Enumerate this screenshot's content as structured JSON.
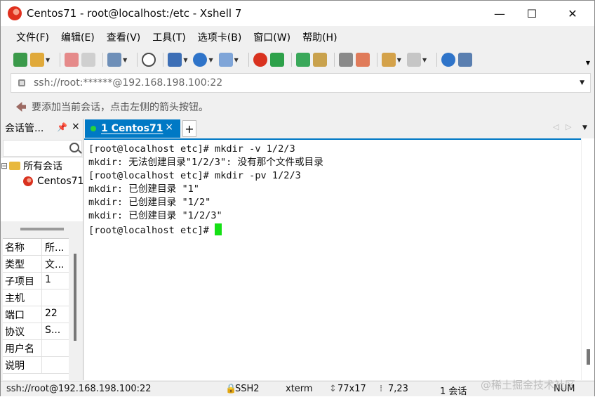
{
  "window": {
    "title": "Centos71 - root@localhost:/etc - Xshell 7",
    "minimize_glyph": "—",
    "maximize_glyph": "☐",
    "close_glyph": "✕"
  },
  "menu": [
    "文件(F)",
    "编辑(E)",
    "查看(V)",
    "工具(T)",
    "选项卡(B)",
    "窗口(W)",
    "帮助(H)"
  ],
  "toolbar_icons": [
    "new-session-icon",
    "open-folder-icon",
    "reconnect-icon",
    "disconnect-icon",
    "properties-icon",
    "find-icon",
    "transfer-icon",
    "globe-icon",
    "font-icon",
    "xshell-icon",
    "xftp-icon",
    "fullscreen-icon",
    "lock-icon",
    "keyboard-icon",
    "highlight-icon",
    "compose-icon",
    "layout-icon",
    "help-icon",
    "chat-icon"
  ],
  "address": {
    "text": "ssh://root:******@192.168.198.100:22"
  },
  "hint": {
    "text": "要添加当前会话，点击左侧的箭头按钮。"
  },
  "session_panel": {
    "title": "会话管...",
    "pin_glyph": "ᵖ",
    "close_glyph": "×",
    "tree_root": "所有会话",
    "tree_expand": "⊟",
    "tree_child": "Centos71",
    "properties": [
      {
        "key": "名称",
        "value": "所..."
      },
      {
        "key": "类型",
        "value": "文..."
      },
      {
        "key": "子项目",
        "value": "1"
      },
      {
        "key": "主机",
        "value": ""
      },
      {
        "key": "端口",
        "value": "22"
      },
      {
        "key": "协议",
        "value": "S..."
      },
      {
        "key": "用户名",
        "value": ""
      },
      {
        "key": "说明",
        "value": ""
      }
    ]
  },
  "tabs": {
    "active_label": "1 Centos71",
    "close_glyph": "×",
    "add_glyph": "+",
    "left_glyph": "◁",
    "right_glyph": "▷",
    "menu_glyph": "▼"
  },
  "terminal": {
    "lines": [
      "[root@localhost etc]# mkdir -v 1/2/3",
      "mkdir: 无法创建目录\"1/2/3\": 没有那个文件或目录",
      "[root@localhost etc]# mkdir -pv 1/2/3",
      "mkdir: 已创建目录 \"1\"",
      "mkdir: 已创建目录 \"1/2\"",
      "mkdir: 已创建目录 \"1/2/3\"",
      "[root@localhost etc]# "
    ],
    "cursor_color": "#15e015"
  },
  "status": {
    "connection": "ssh://root@192.168.198.100:22",
    "protocol": "SSH2",
    "terminal_type": "xterm",
    "size": "77x17",
    "position": "7,23",
    "sessions": "1 会话",
    "numlock": "NUM"
  },
  "watermark": "@稀土掘金技术社区",
  "colors": {
    "tab_active": "#0079c5",
    "connected_dot": "#28d23c"
  }
}
